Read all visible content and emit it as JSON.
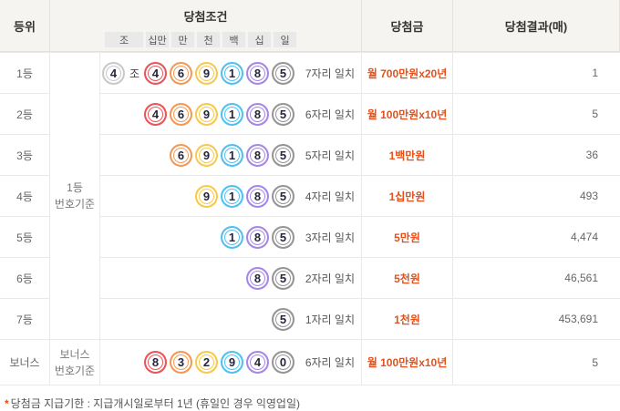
{
  "table": {
    "header": {
      "rank": "등위",
      "condition": "당첨조건",
      "prize": "당첨금",
      "result": "당첨결과(매)",
      "positions": [
        "조",
        "십만",
        "만",
        "천",
        "백",
        "십",
        "일"
      ]
    },
    "basis": {
      "first_line1": "1등",
      "first_line2": "번호기준",
      "bonus_line1": "보너스",
      "bonus_line2": "번호기준"
    },
    "group_suffix": "조",
    "colors": {
      "jo": "#c9c9c9",
      "sibman": "#e9555a",
      "man": "#f29a55",
      "cheon": "#f6c94f",
      "baek": "#4fc0f2",
      "sip": "#a687e6",
      "il": "#959595",
      "prize_text": "#e3511c",
      "header_bg": "#f6f4f1"
    },
    "rows": [
      {
        "rank": "1등",
        "group_ball": "4",
        "balls": [
          [
            "4",
            "sibman"
          ],
          [
            "6",
            "man"
          ],
          [
            "9",
            "cheon"
          ],
          [
            "1",
            "baek"
          ],
          [
            "8",
            "sip"
          ],
          [
            "5",
            "il"
          ]
        ],
        "match": "7자리 일치",
        "prize": "월 700만원x20년",
        "count": "1"
      },
      {
        "rank": "2등",
        "group_ball": null,
        "balls": [
          [
            "4",
            "sibman"
          ],
          [
            "6",
            "man"
          ],
          [
            "9",
            "cheon"
          ],
          [
            "1",
            "baek"
          ],
          [
            "8",
            "sip"
          ],
          [
            "5",
            "il"
          ]
        ],
        "match": "6자리 일치",
        "prize": "월 100만원x10년",
        "count": "5"
      },
      {
        "rank": "3등",
        "group_ball": null,
        "balls": [
          [
            "6",
            "man"
          ],
          [
            "9",
            "cheon"
          ],
          [
            "1",
            "baek"
          ],
          [
            "8",
            "sip"
          ],
          [
            "5",
            "il"
          ]
        ],
        "match": "5자리 일치",
        "prize": "1백만원",
        "count": "36"
      },
      {
        "rank": "4등",
        "group_ball": null,
        "balls": [
          [
            "9",
            "cheon"
          ],
          [
            "1",
            "baek"
          ],
          [
            "8",
            "sip"
          ],
          [
            "5",
            "il"
          ]
        ],
        "match": "4자리 일치",
        "prize": "1십만원",
        "count": "493"
      },
      {
        "rank": "5등",
        "group_ball": null,
        "balls": [
          [
            "1",
            "baek"
          ],
          [
            "8",
            "sip"
          ],
          [
            "5",
            "il"
          ]
        ],
        "match": "3자리 일치",
        "prize": "5만원",
        "count": "4,474"
      },
      {
        "rank": "6등",
        "group_ball": null,
        "balls": [
          [
            "8",
            "sip"
          ],
          [
            "5",
            "il"
          ]
        ],
        "match": "2자리 일치",
        "prize": "5천원",
        "count": "46,561"
      },
      {
        "rank": "7등",
        "group_ball": null,
        "balls": [
          [
            "5",
            "il"
          ]
        ],
        "match": "1자리 일치",
        "prize": "1천원",
        "count": "453,691"
      },
      {
        "rank": "보너스",
        "group_ball": null,
        "balls": [
          [
            "8",
            "sibman"
          ],
          [
            "3",
            "man"
          ],
          [
            "2",
            "cheon"
          ],
          [
            "9",
            "baek"
          ],
          [
            "4",
            "sip"
          ],
          [
            "0",
            "il"
          ]
        ],
        "match": "6자리 일치",
        "prize": "월 100만원x10년",
        "count": "5"
      }
    ]
  },
  "footnote": {
    "mark": "*",
    "text": "당첨금 지급기한 : 지급개시일로부터 1년 (휴일인 경우 익영업일)"
  }
}
